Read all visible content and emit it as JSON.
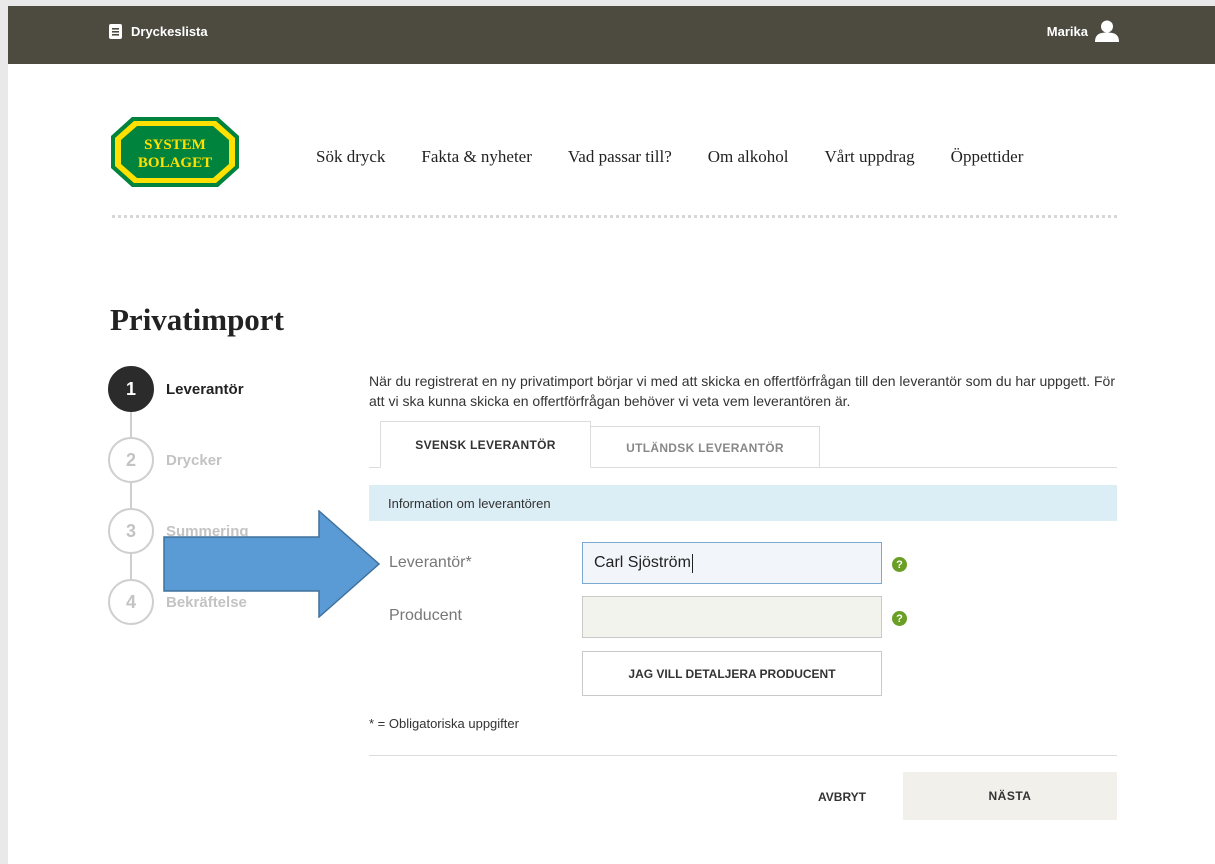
{
  "topbar": {
    "list_label": "Dryckeslista",
    "user_name": "Marika"
  },
  "logo": {
    "line1": "SYSTEM",
    "line2": "BOLAGET"
  },
  "nav": {
    "items": [
      "Sök dryck",
      "Fakta & nyheter",
      "Vad passar till?",
      "Om alkohol",
      "Vårt uppdrag",
      "Öppettider"
    ]
  },
  "page": {
    "title": "Privatimport",
    "intro": "När du registrerat en ny privatimport börjar vi med att skicka en offertförfrågan till den leverantör som du har uppgett. För att vi ska kunna skicka en offertförfrågan behöver vi veta vem leverantören är."
  },
  "steps": [
    {
      "number": "1",
      "label": "Leverantör"
    },
    {
      "number": "2",
      "label": "Drycker"
    },
    {
      "number": "3",
      "label": "Summering"
    },
    {
      "number": "4",
      "label": "Bekräftelse"
    }
  ],
  "tabs": {
    "swedish": "SVENSK LEVERANTÖR",
    "foreign": "UTLÄNDSK LEVERANTÖR"
  },
  "form": {
    "section_title": "Information om leverantören",
    "supplier_label": "Leverantör*",
    "supplier_value": "Carl Sjöström",
    "producer_label": "Producent",
    "producer_value": "",
    "help_symbol": "?",
    "detail_button": "JAG VILL DETALJERA PRODUCENT",
    "required_note": "* = Obligatoriska uppgifter"
  },
  "actions": {
    "cancel": "AVBRYT",
    "next": "NÄSTA"
  },
  "colors": {
    "topbar": "#4d4b40",
    "logo_green": "#00843d",
    "logo_yellow": "#ffe000",
    "info_bar": "#dbedf5",
    "arrow_fill": "#5b9bd5",
    "help_green": "#6a9f25"
  }
}
